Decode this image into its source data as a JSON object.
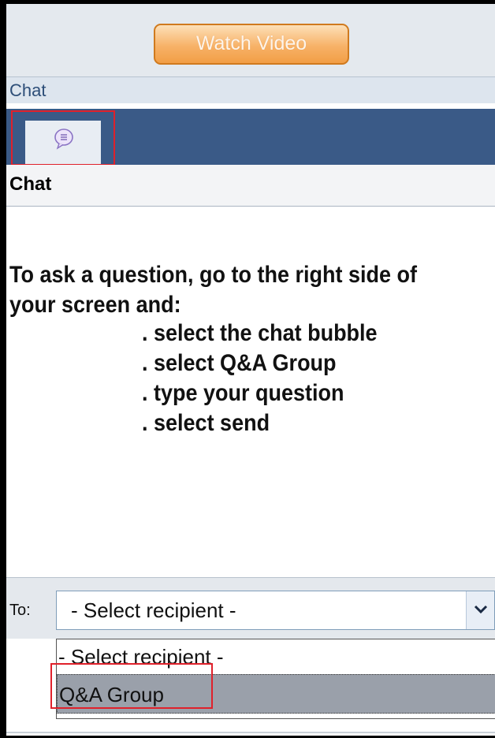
{
  "toolbar": {
    "watch_video_label": "Watch Video"
  },
  "chat_section": {
    "header_label": "Chat",
    "tab_icon": "chat-bubble-icon",
    "subheader_label": "Chat"
  },
  "message": {
    "intro": "To ask a question, go to the right side of",
    "line2": "your screen and:",
    "steps": [
      ". select the chat bubble",
      ". select Q&A Group",
      ". type your question",
      ". select send"
    ]
  },
  "recipient": {
    "to_label": "To:",
    "selected": "- Select recipient -",
    "options": [
      "- Select recipient -",
      "Q&A Group"
    ]
  },
  "colors": {
    "highlight": "#e0212b",
    "tab_bar": "#3a5a87",
    "button_orange": "#f7b268"
  }
}
